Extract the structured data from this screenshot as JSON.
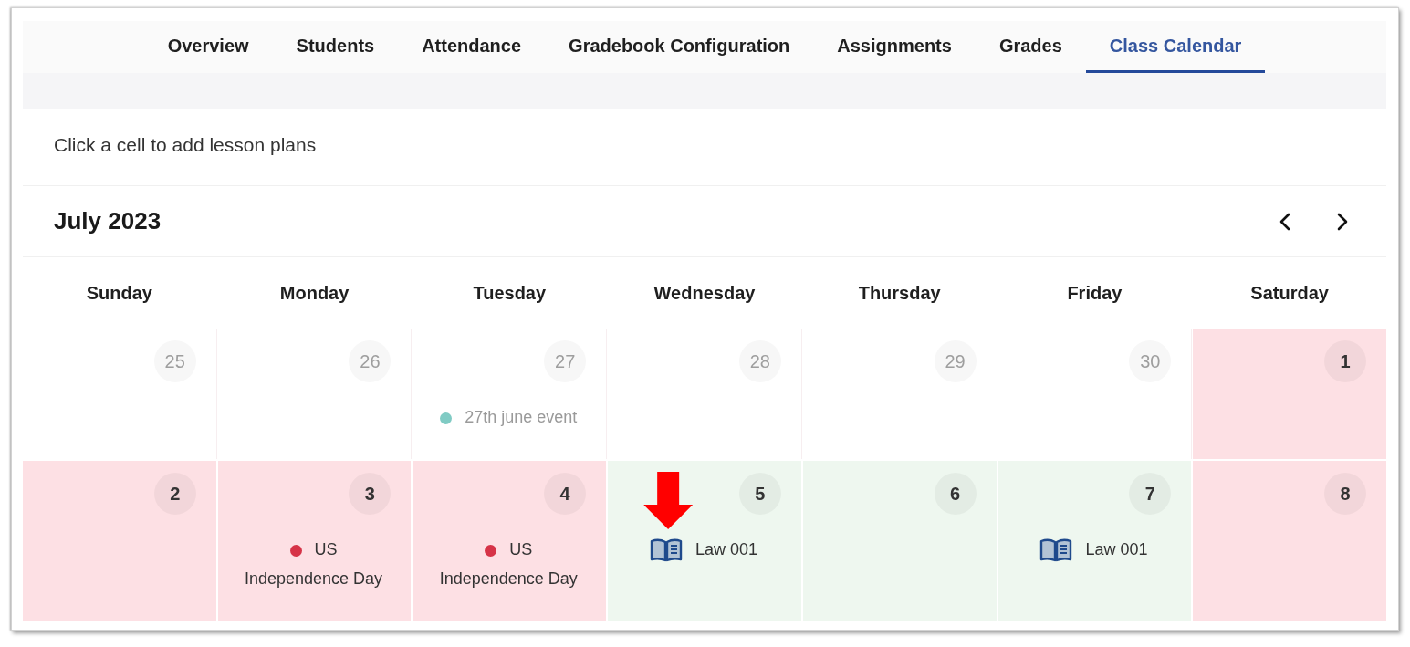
{
  "tabs": [
    {
      "label": "Overview",
      "selected": false
    },
    {
      "label": "Students",
      "selected": false
    },
    {
      "label": "Attendance",
      "selected": false
    },
    {
      "label": "Gradebook Configuration",
      "selected": false
    },
    {
      "label": "Assignments",
      "selected": false
    },
    {
      "label": "Grades",
      "selected": false
    },
    {
      "label": "Class Calendar",
      "selected": true
    }
  ],
  "instruction": "Click a cell to add lesson plans",
  "calendar": {
    "title": "July 2023",
    "weekdays": [
      "Sunday",
      "Monday",
      "Tuesday",
      "Wednesday",
      "Thursday",
      "Friday",
      "Saturday"
    ],
    "weeks": [
      [
        {
          "day": "25",
          "kind": "outside"
        },
        {
          "day": "26",
          "kind": "outside"
        },
        {
          "day": "27",
          "kind": "outside",
          "events": [
            {
              "kind": "dot",
              "label": "27th june event",
              "color": "#80cbc4",
              "callout": false
            }
          ]
        },
        {
          "day": "28",
          "kind": "outside"
        },
        {
          "day": "29",
          "kind": "outside"
        },
        {
          "day": "30",
          "kind": "outside"
        },
        {
          "day": "1",
          "kind": "off"
        }
      ],
      [
        {
          "day": "2",
          "kind": "off"
        },
        {
          "day": "3",
          "kind": "off",
          "events": [
            {
              "kind": "dot",
              "label": "US Independence Day",
              "color": "#d63347",
              "callout": false
            }
          ]
        },
        {
          "day": "4",
          "kind": "off",
          "events": [
            {
              "kind": "dot",
              "label": "US Independence Day",
              "color": "#d63347",
              "callout": false
            }
          ]
        },
        {
          "day": "5",
          "kind": "class",
          "events": [
            {
              "kind": "lesson",
              "label": "Law 001",
              "callout": true
            }
          ]
        },
        {
          "day": "6",
          "kind": "class"
        },
        {
          "day": "7",
          "kind": "class",
          "events": [
            {
              "kind": "lesson",
              "label": "Law 001",
              "callout": false
            }
          ]
        },
        {
          "day": "8",
          "kind": "off"
        }
      ]
    ]
  }
}
